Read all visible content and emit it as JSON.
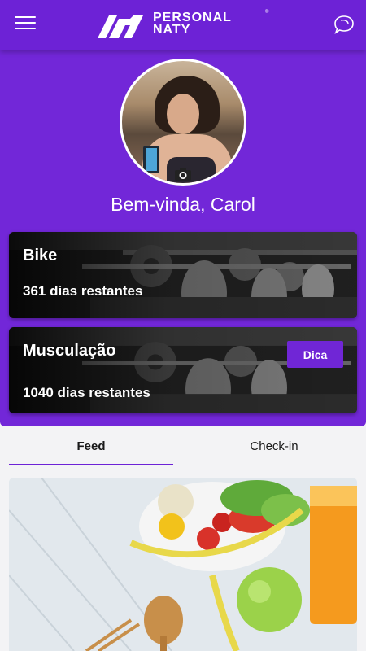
{
  "header": {
    "logo_line1": "PERSONAL",
    "logo_line2": "NATY",
    "logo_tm": "®",
    "menu_icon": "hamburger-menu-icon",
    "chat_icon": "chat-bubbles-icon"
  },
  "profile": {
    "welcome": "Bem-vinda, Carol",
    "camera_icon": "camera-icon"
  },
  "plans": [
    {
      "title": "Bike",
      "days": "361 dias restantes"
    },
    {
      "title": "Musculação",
      "days": "1040 dias restantes",
      "button": "Dica"
    }
  ],
  "tabs": [
    {
      "label": "Feed",
      "active": true
    },
    {
      "label": "Check-in",
      "active": false
    }
  ],
  "colors": {
    "brand_purple": "#6d22d6",
    "hero_purple": "#7227d8",
    "background": "#f3f3f5"
  }
}
